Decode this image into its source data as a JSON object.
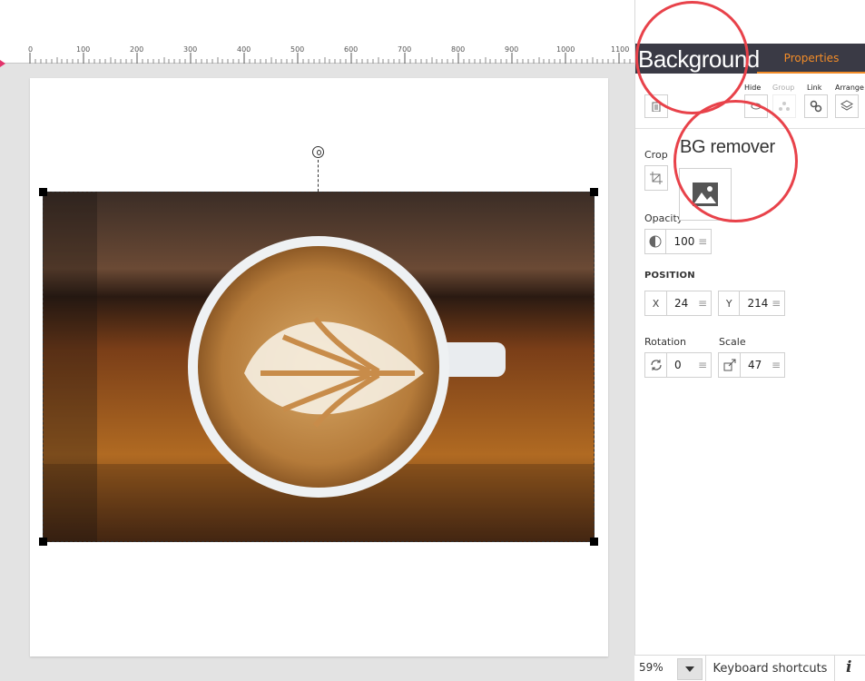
{
  "ruler": {
    "ticks": [
      "0",
      "100",
      "200",
      "300",
      "400",
      "500",
      "600",
      "700",
      "800",
      "900",
      "1000",
      "1100"
    ]
  },
  "panel": {
    "tabs": {
      "background": "Background",
      "properties": "Properties"
    },
    "tools": {
      "hide": "Hide",
      "group": "Group",
      "link": "Link",
      "arrange": "Arrange"
    },
    "crop_label": "Crop",
    "bg_remover_label": "BG remover",
    "opacity": {
      "label": "Opacity",
      "value": "100"
    },
    "position": {
      "label": "POSITION",
      "x_label": "X",
      "x_value": "24",
      "y_label": "Y",
      "y_value": "214"
    },
    "rotation": {
      "label": "Rotation",
      "value": "0"
    },
    "scale": {
      "label": "Scale",
      "value": "47"
    }
  },
  "bottom_bar": {
    "zoom": "59%",
    "shortcuts": "Keyboard shortcuts",
    "info": "i"
  },
  "colors": {
    "accent": "#f28c28",
    "header": "#3a3a45",
    "highlight": "#e8424a"
  }
}
